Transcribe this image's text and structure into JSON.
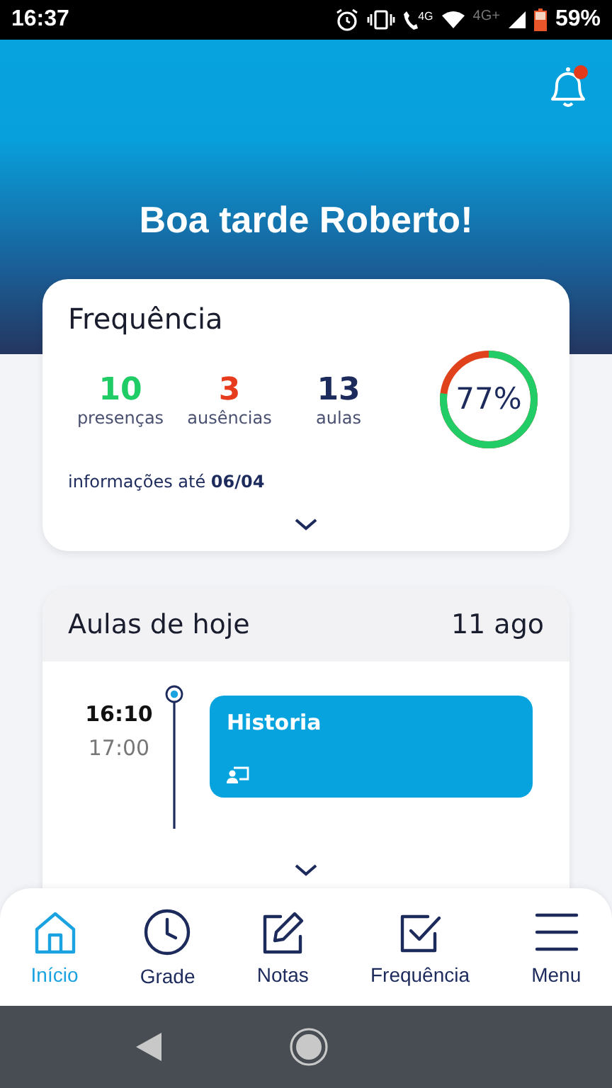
{
  "status_bar": {
    "time": "16:37",
    "network_call": "4G",
    "network_data": "4G+",
    "battery": "59%"
  },
  "notifications": {
    "unread": true
  },
  "greeting": "Boa tarde Roberto!",
  "attendance": {
    "title": "Frequência",
    "stats": [
      {
        "value": "10",
        "label": "presenças",
        "color": "#1fcc66"
      },
      {
        "value": "3",
        "label": "ausências",
        "color": "#e63b1c"
      },
      {
        "value": "13",
        "label": "aulas",
        "color": "#1c2a5c"
      }
    ],
    "info": "informações até **06/04**",
    "percent": "77%"
  },
  "today": {
    "title": "Aulas de hoje",
    "date": "11 ago",
    "classes": [
      {
        "start": "16:10",
        "end": "17:00",
        "subject": "Historia"
      }
    ]
  },
  "bottom_nav": [
    {
      "label": "Início",
      "kind": "home",
      "selected": true
    },
    {
      "label": "Grade",
      "kind": "clock",
      "selected": false
    },
    {
      "label": "Notas",
      "kind": "edit",
      "selected": false
    },
    {
      "label": "Frequência",
      "kind": "check",
      "selected": false
    },
    {
      "label": "Menu",
      "kind": "menu",
      "selected": false
    }
  ]
}
